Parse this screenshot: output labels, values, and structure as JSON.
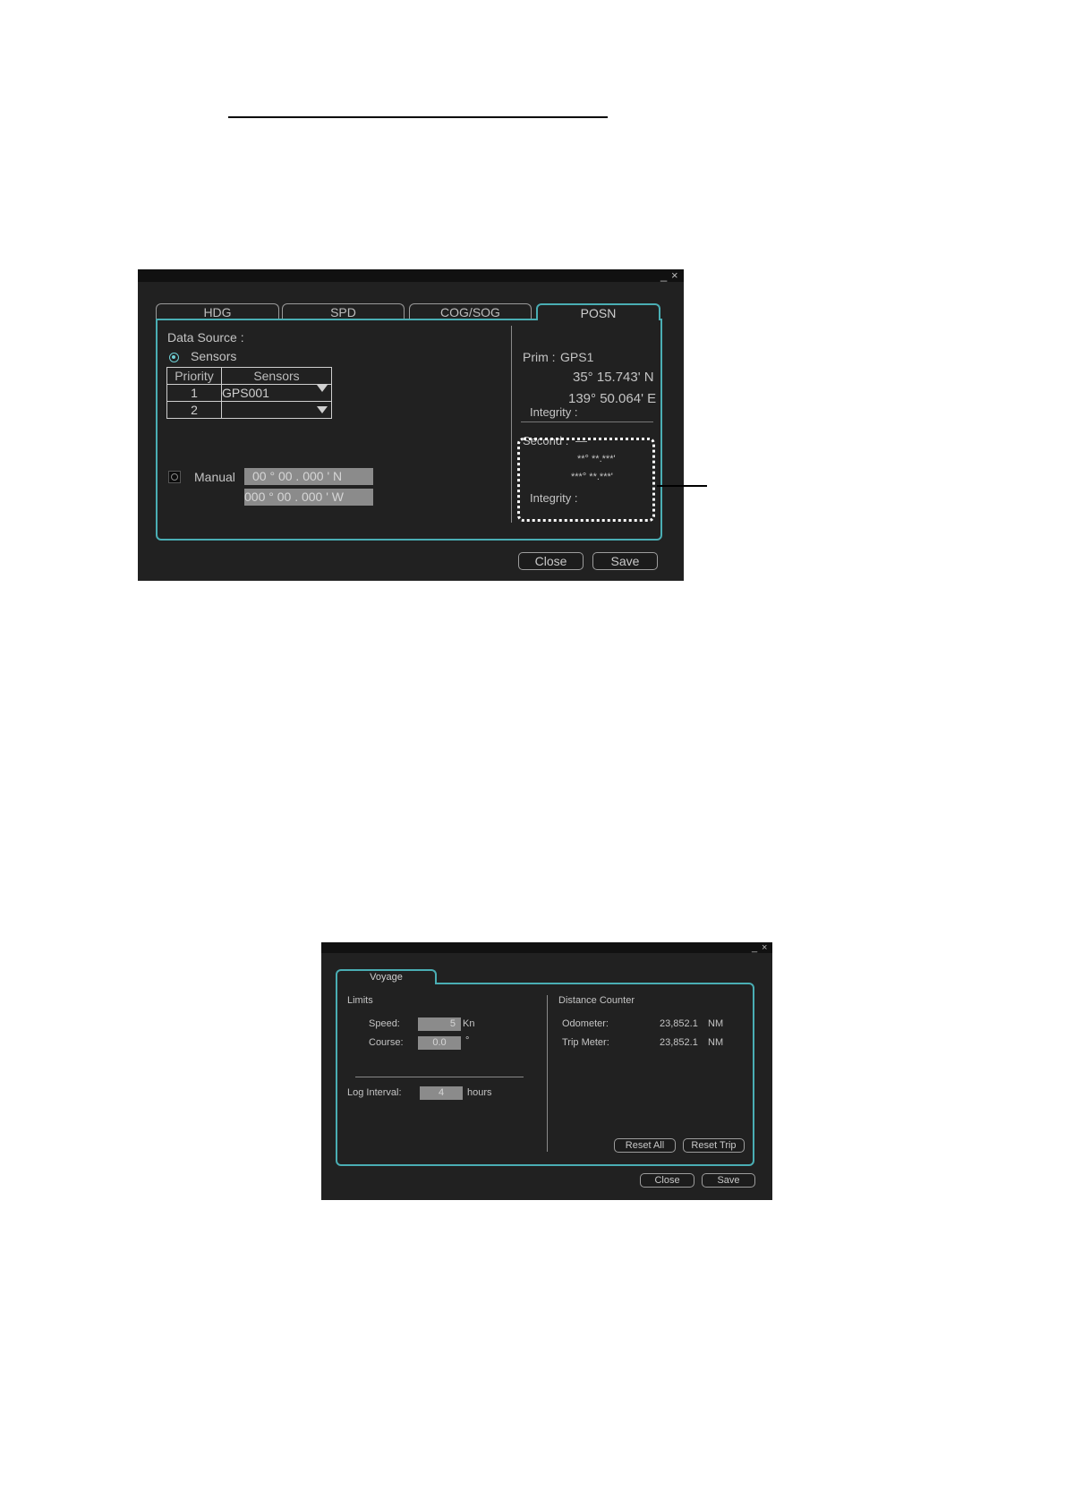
{
  "sensor_dialog": {
    "tabs": [
      "HDG",
      "SPD",
      "COG/SOG",
      "POSN"
    ],
    "data_source_label": "Data Source :",
    "sensors_radio_label": "Sensors",
    "table": {
      "headers": [
        "Priority",
        "Sensors"
      ],
      "rows": [
        {
          "priority": "1",
          "sensor": "GPS001"
        },
        {
          "priority": "2",
          "sensor": ""
        }
      ]
    },
    "manual_label": "Manual",
    "manual_lat": "00 ° 00 . 000 ' N",
    "manual_lon": "000 ° 00 . 000 ' W",
    "prim_label": "Prim :",
    "prim_source": "GPS1",
    "prim_lat": "35° 15.743' N",
    "prim_lon": "139° 50.064' E",
    "prim_integrity": "Integrity :",
    "second_label": "Second :",
    "second_source": "—",
    "second_lat": "**° **.***'",
    "second_lon": "***° **.***'",
    "second_integrity": "Integrity :",
    "close_label": "Close",
    "save_label": "Save",
    "window_controls": {
      "minimize": "_",
      "close": "×"
    }
  },
  "voyage_dialog": {
    "tab": "Voyage",
    "limits_label": "Limits",
    "speed_label": "Speed:",
    "speed_value": "5",
    "speed_unit": "Kn",
    "course_label": "Course:",
    "course_value": "0.0",
    "course_unit": "°",
    "log_interval_label": "Log Interval:",
    "log_interval_value": "4",
    "log_interval_unit": "hours",
    "distance_counter_label": "Distance Counter",
    "odometer_label": "Odometer:",
    "odometer_value": "23,852.1",
    "odometer_unit": "NM",
    "trip_meter_label": "Trip Meter:",
    "trip_meter_value": "23,852.1",
    "trip_meter_unit": "NM",
    "reset_all_label": "Reset All",
    "reset_trip_label": "Reset Trip",
    "close_label": "Close",
    "save_label": "Save",
    "window_controls": {
      "minimize": "_",
      "close": "×"
    }
  }
}
